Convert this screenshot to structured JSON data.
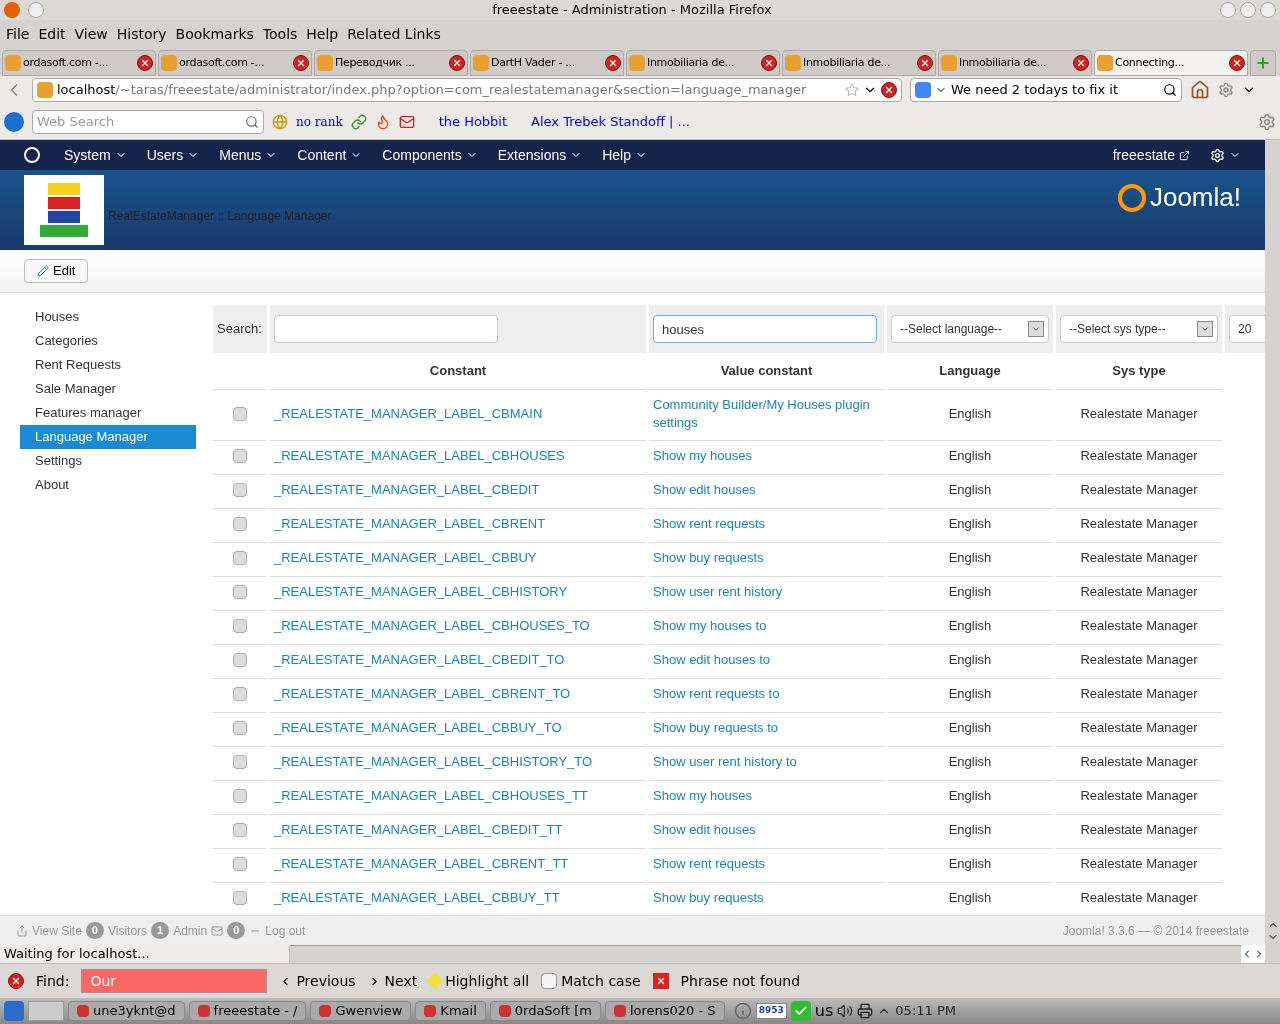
{
  "window": {
    "title": "freeestate - Administration - Mozilla Firefox"
  },
  "menubar": [
    "File",
    "Edit",
    "View",
    "History",
    "Bookmarks",
    "Tools",
    "Help",
    "Related Links"
  ],
  "tabs": [
    {
      "label": "ordasoft.com -...",
      "selected": false
    },
    {
      "label": "ordasoft.com -...",
      "selected": false
    },
    {
      "label": "Переводчик ...",
      "selected": false
    },
    {
      "label": "DartH Vader - ...",
      "selected": false
    },
    {
      "label": "Inmobiliaria de...",
      "selected": false
    },
    {
      "label": "Inmobiliaria de...",
      "selected": false
    },
    {
      "label": "Inmobiliaria de...",
      "selected": false
    },
    {
      "label": "Connecting...",
      "selected": true
    }
  ],
  "address": {
    "host": "localhost",
    "path": "/~taras/freeestate/administrator/index.php?option=com_realestatemanager&section=language_manager"
  },
  "search_box": {
    "value": "We need 2 todays to fix it"
  },
  "bookmarks_bar": {
    "search_placeholder": "Web Search",
    "rank": "no rank",
    "links": [
      "the Hobbit",
      "Alex Trebek Standoff | ..."
    ]
  },
  "joomla": {
    "menu": [
      "System",
      "Users",
      "Menus",
      "Content",
      "Components",
      "Extensions",
      "Help"
    ],
    "user": "freeestate",
    "page_title": "RealEstateManager :: Language Manager",
    "logo_text": "Joomla!",
    "toolbar": [
      "Edit"
    ],
    "sidebar": [
      {
        "label": "Houses",
        "selected": false
      },
      {
        "label": "Categories",
        "selected": false
      },
      {
        "label": "Rent Requests",
        "selected": false
      },
      {
        "label": "Sale Manager",
        "selected": false
      },
      {
        "label": "Features manager",
        "selected": false
      },
      {
        "label": "Language Manager",
        "selected": true
      },
      {
        "label": "Settings",
        "selected": false
      },
      {
        "label": "About",
        "selected": false
      }
    ],
    "filters": {
      "search_label": "Search:",
      "value_search": "houses",
      "language": "--Select language--",
      "sys_type": "--Select sys type--",
      "limit": "20"
    },
    "columns": [
      "Constant",
      "Value constant",
      "Language",
      "Sys type"
    ],
    "rows": [
      {
        "checked": false,
        "constant": "_REALESTATE_MANAGER_LABEL_CBMAIN",
        "value": "Community Builder/My Houses plugin settings",
        "language": "English",
        "sys_type": "Realestate Manager"
      },
      {
        "checked": false,
        "constant": "_REALESTATE_MANAGER_LABEL_CBHOUSES",
        "value": "Show my houses",
        "language": "English",
        "sys_type": "Realestate Manager"
      },
      {
        "checked": false,
        "constant": "_REALESTATE_MANAGER_LABEL_CBEDIT",
        "value": "Show edit houses",
        "language": "English",
        "sys_type": "Realestate Manager"
      },
      {
        "checked": false,
        "constant": "_REALESTATE_MANAGER_LABEL_CBRENT",
        "value": "Show rent requests",
        "language": "English",
        "sys_type": "Realestate Manager"
      },
      {
        "checked": false,
        "constant": "_REALESTATE_MANAGER_LABEL_CBBUY",
        "value": "Show buy requests",
        "language": "English",
        "sys_type": "Realestate Manager"
      },
      {
        "checked": false,
        "constant": "_REALESTATE_MANAGER_LABEL_CBHISTORY",
        "value": "Show user rent history",
        "language": "English",
        "sys_type": "Realestate Manager"
      },
      {
        "checked": false,
        "constant": "_REALESTATE_MANAGER_LABEL_CBHOUSES_TO",
        "value": "Show my houses to",
        "language": "English",
        "sys_type": "Realestate Manager"
      },
      {
        "checked": false,
        "constant": "_REALESTATE_MANAGER_LABEL_CBEDIT_TO",
        "value": "Show edit houses to",
        "language": "English",
        "sys_type": "Realestate Manager"
      },
      {
        "checked": false,
        "constant": "_REALESTATE_MANAGER_LABEL_CBRENT_TO",
        "value": "Show rent requests to",
        "language": "English",
        "sys_type": "Realestate Manager"
      },
      {
        "checked": false,
        "constant": "_REALESTATE_MANAGER_LABEL_CBBUY_TO",
        "value": "Show buy requests to",
        "language": "English",
        "sys_type": "Realestate Manager"
      },
      {
        "checked": false,
        "constant": "_REALESTATE_MANAGER_LABEL_CBHISTORY_TO",
        "value": "Show user rent history to",
        "language": "English",
        "sys_type": "Realestate Manager"
      },
      {
        "checked": false,
        "constant": "_REALESTATE_MANAGER_LABEL_CBHOUSES_TT",
        "value": "Show my houses",
        "language": "English",
        "sys_type": "Realestate Manager"
      },
      {
        "checked": false,
        "constant": "_REALESTATE_MANAGER_LABEL_CBEDIT_TT",
        "value": "Show edit houses",
        "language": "English",
        "sys_type": "Realestate Manager"
      },
      {
        "checked": false,
        "constant": "_REALESTATE_MANAGER_LABEL_CBRENT_TT",
        "value": "Show rent requests",
        "language": "English",
        "sys_type": "Realestate Manager"
      },
      {
        "checked": false,
        "constant": "_REALESTATE_MANAGER_LABEL_CBBUY_TT",
        "value": "Show buy requests",
        "language": "English",
        "sys_type": "Realestate Manager"
      }
    ],
    "footer": {
      "view_site": "View Site",
      "visitors_count": "0",
      "visitors": "Visitors",
      "admin_count": "1",
      "admin": "Admin",
      "messages_count": "0",
      "logout": "Log out",
      "version": "Joomla! 3.3.6 — © 2014 freeestate"
    }
  },
  "status": "Waiting for localhost...",
  "find_bar": {
    "label": "Find:",
    "value": "Our",
    "not_found": true,
    "previous": "Previous",
    "next": "Next",
    "highlight": "Highlight all",
    "match_case": {
      "label": "Match case",
      "checked": false
    },
    "message": "Phrase not found"
  },
  "taskbar": {
    "tasks": [
      "une3yknt@d",
      "freeestate - /",
      "Gwenview",
      "Kmail",
      "0rdaSoft [m",
      "lorens020 - S"
    ],
    "mail_count": "8953",
    "keyboard": "us",
    "clock": "05:11 PM"
  }
}
